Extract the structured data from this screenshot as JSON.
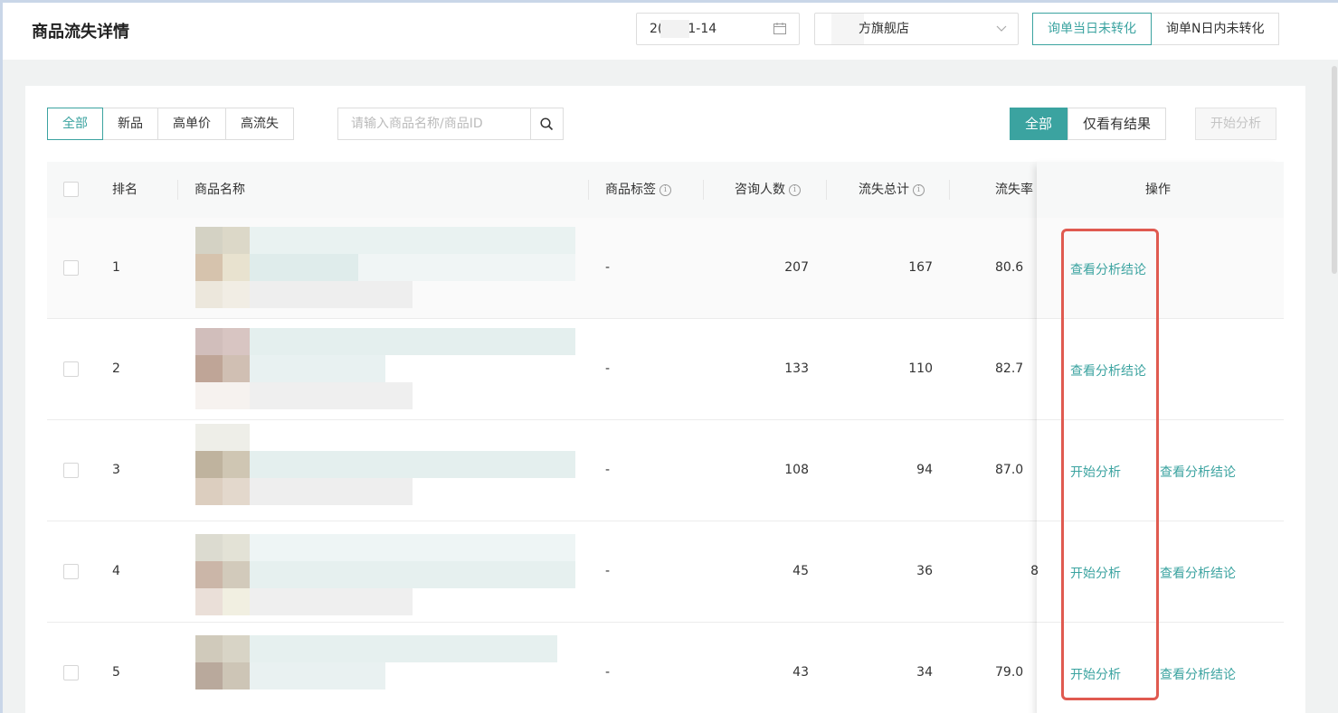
{
  "header": {
    "title": "商品流失详情",
    "date_prefix": "2(",
    "date_suffix": "1-14",
    "shop_name": "方旗舰店",
    "conversion_tabs": [
      "询单当日未转化",
      "询单N日内未转化"
    ]
  },
  "filters": {
    "category_tabs": [
      "全部",
      "新品",
      "高单价",
      "高流失"
    ],
    "search_placeholder": "请输入商品名称/商品ID",
    "result_tabs": [
      "全部",
      "仅看有结果"
    ],
    "start_analysis": "开始分析"
  },
  "table": {
    "columns": {
      "rank": "排名",
      "name": "商品名称",
      "tag": "商品标签",
      "consult": "咨询人数",
      "loss": "流失总计",
      "rate": "流失率",
      "ops": "操作"
    },
    "rows": [
      {
        "rank": "1",
        "tag": "-",
        "consult": "207",
        "loss": "167",
        "rate": "80.6",
        "op1": "查看分析结论",
        "op2": ""
      },
      {
        "rank": "2",
        "tag": "-",
        "consult": "133",
        "loss": "110",
        "rate": "82.7",
        "op1": "查看分析结论",
        "op2": ""
      },
      {
        "rank": "3",
        "tag": "-",
        "consult": "108",
        "loss": "94",
        "rate": "87.0",
        "op1": "开始分析",
        "op2": "查看分析结论"
      },
      {
        "rank": "4",
        "tag": "-",
        "consult": "45",
        "loss": "36",
        "rate": "8",
        "op1": "开始分析",
        "op2": "查看分析结论"
      },
      {
        "rank": "5",
        "tag": "-",
        "consult": "43",
        "loss": "34",
        "rate": "79.0",
        "op1": "开始分析",
        "op2": "查看分析结论"
      }
    ]
  },
  "colors": {
    "accent": "#3ba3a0",
    "highlight": "#e05a50"
  }
}
